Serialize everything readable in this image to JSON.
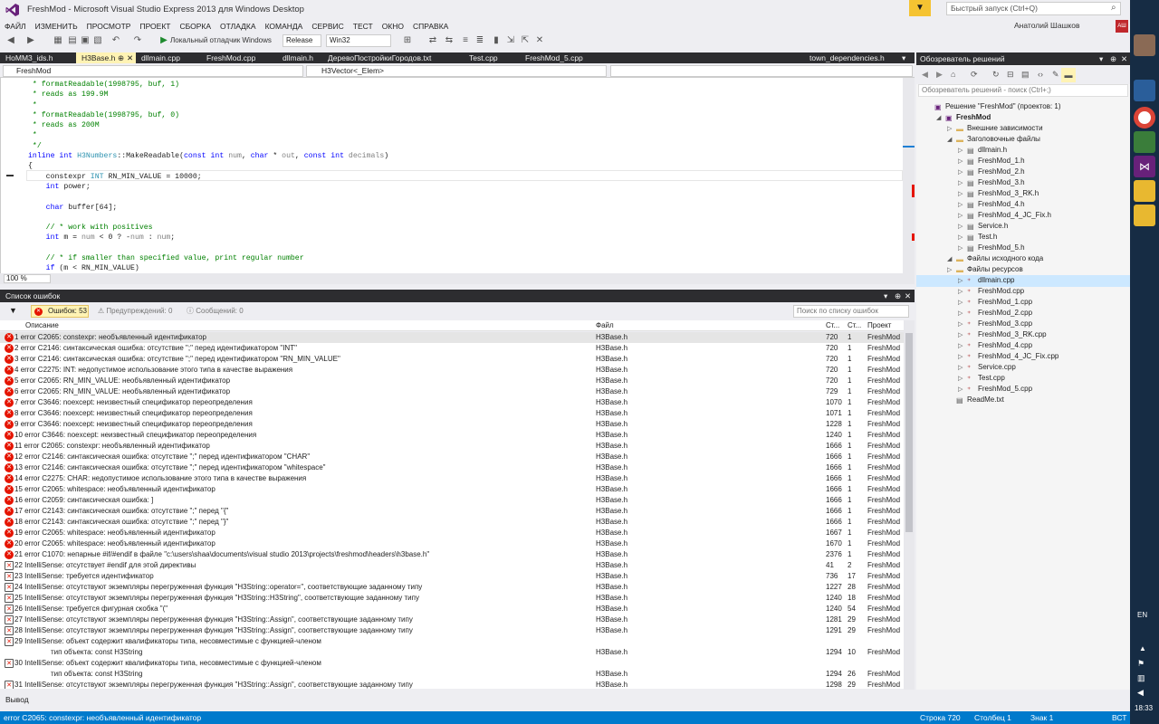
{
  "window": {
    "title": "FreshMod - Microsoft Visual Studio Express 2013 для Windows Desktop",
    "quick_launch": "Быстрый запуск (Ctrl+Q)",
    "user": "Анатолий Шашков",
    "user_badge": "АШ"
  },
  "menu": [
    "ФАЙЛ",
    "ИЗМЕНИТЬ",
    "ПРОСМОТР",
    "ПРОЕКТ",
    "СБОРКА",
    "ОТЛАДКА",
    "КОМАНДА",
    "СЕРВИС",
    "ТЕСТ",
    "ОКНО",
    "СПРАВКА"
  ],
  "toolbar": {
    "debugger": "Локальный отладчик Windows",
    "config": "Release",
    "platform": "Win32"
  },
  "tabs": [
    "HoMM3_ids.h",
    "H3Base.h",
    "dllmain.cpp",
    "FreshMod.cpp",
    "dllmain.h",
    "ДеревоПостройкиГородов.txt",
    "Test.cpp",
    "FreshMod_5.cpp",
    "town_dependencies.h"
  ],
  "nav": {
    "scope": "FreshMod",
    "symbol": "H3Vector<_Elem>"
  },
  "editor": {
    "zoom": "100 %"
  },
  "error_list": {
    "title": "Список ошибок",
    "errors_label": "Ошибок: 53",
    "warnings_label": "Предупреждений: 0",
    "messages_label": "Сообщений: 0",
    "search_placeholder": "Поиск по списку ошибок",
    "columns": {
      "description": "Описание",
      "file": "Файл",
      "line": "Ст...",
      "col": "Ст...",
      "project": "Проект"
    },
    "rows": [
      {
        "n": "1",
        "d": "error C2065: constexpr: необъявленный идентификатор",
        "f": "H3Base.h",
        "l": "720",
        "c": "1",
        "p": "FreshMod",
        "t": "e"
      },
      {
        "n": "2",
        "d": "error C2146: синтаксическая ошибка: отсутствие \";\" перед идентификатором \"INT\"",
        "f": "H3Base.h",
        "l": "720",
        "c": "1",
        "p": "FreshMod",
        "t": "e"
      },
      {
        "n": "3",
        "d": "error C2146: синтаксическая ошибка: отсутствие \";\" перед идентификатором \"RN_MIN_VALUE\"",
        "f": "H3Base.h",
        "l": "720",
        "c": "1",
        "p": "FreshMod",
        "t": "e"
      },
      {
        "n": "4",
        "d": "error C2275: INT: недопустимое использование этого типа в качестве выражения",
        "f": "H3Base.h",
        "l": "720",
        "c": "1",
        "p": "FreshMod",
        "t": "e"
      },
      {
        "n": "5",
        "d": "error C2065: RN_MIN_VALUE: необъявленный идентификатор",
        "f": "H3Base.h",
        "l": "720",
        "c": "1",
        "p": "FreshMod",
        "t": "e"
      },
      {
        "n": "6",
        "d": "error C2065: RN_MIN_VALUE: необъявленный идентификатор",
        "f": "H3Base.h",
        "l": "729",
        "c": "1",
        "p": "FreshMod",
        "t": "e"
      },
      {
        "n": "7",
        "d": "error C3646: noexcept: неизвестный спецификатор переопределения",
        "f": "H3Base.h",
        "l": "1070",
        "c": "1",
        "p": "FreshMod",
        "t": "e"
      },
      {
        "n": "8",
        "d": "error C3646: noexcept: неизвестный спецификатор переопределения",
        "f": "H3Base.h",
        "l": "1071",
        "c": "1",
        "p": "FreshMod",
        "t": "e"
      },
      {
        "n": "9",
        "d": "error C3646: noexcept: неизвестный спецификатор переопределения",
        "f": "H3Base.h",
        "l": "1228",
        "c": "1",
        "p": "FreshMod",
        "t": "e"
      },
      {
        "n": "10",
        "d": "error C3646: noexcept: неизвестный спецификатор переопределения",
        "f": "H3Base.h",
        "l": "1240",
        "c": "1",
        "p": "FreshMod",
        "t": "e"
      },
      {
        "n": "11",
        "d": "error C2065: constexpr: необъявленный идентификатор",
        "f": "H3Base.h",
        "l": "1666",
        "c": "1",
        "p": "FreshMod",
        "t": "e"
      },
      {
        "n": "12",
        "d": "error C2146: синтаксическая ошибка: отсутствие \";\" перед идентификатором \"CHAR\"",
        "f": "H3Base.h",
        "l": "1666",
        "c": "1",
        "p": "FreshMod",
        "t": "e"
      },
      {
        "n": "13",
        "d": "error C2146: синтаксическая ошибка: отсутствие \";\" перед идентификатором \"whitespace\"",
        "f": "H3Base.h",
        "l": "1666",
        "c": "1",
        "p": "FreshMod",
        "t": "e"
      },
      {
        "n": "14",
        "d": "error C2275: CHAR: недопустимое использование этого типа в качестве выражения",
        "f": "H3Base.h",
        "l": "1666",
        "c": "1",
        "p": "FreshMod",
        "t": "e"
      },
      {
        "n": "15",
        "d": "error C2065: whitespace: необъявленный идентификатор",
        "f": "H3Base.h",
        "l": "1666",
        "c": "1",
        "p": "FreshMod",
        "t": "e"
      },
      {
        "n": "16",
        "d": "error C2059: синтаксическая ошибка: ]",
        "f": "H3Base.h",
        "l": "1666",
        "c": "1",
        "p": "FreshMod",
        "t": "e"
      },
      {
        "n": "17",
        "d": "error C2143: синтаксическая ошибка: отсутствие \";\" перед \"{\"",
        "f": "H3Base.h",
        "l": "1666",
        "c": "1",
        "p": "FreshMod",
        "t": "e"
      },
      {
        "n": "18",
        "d": "error C2143: синтаксическая ошибка: отсутствие \";\" перед \"}\"",
        "f": "H3Base.h",
        "l": "1666",
        "c": "1",
        "p": "FreshMod",
        "t": "e"
      },
      {
        "n": "19",
        "d": "error C2065: whitespace: необъявленный идентификатор",
        "f": "H3Base.h",
        "l": "1667",
        "c": "1",
        "p": "FreshMod",
        "t": "e"
      },
      {
        "n": "20",
        "d": "error C2065: whitespace: необъявленный идентификатор",
        "f": "H3Base.h",
        "l": "1670",
        "c": "1",
        "p": "FreshMod",
        "t": "e"
      },
      {
        "n": "21",
        "d": "error C1070: непарные #if/#endif в файле \"c:\\users\\shaa\\documents\\visual studio 2013\\projects\\freshmod\\headers\\h3base.h\"",
        "f": "H3Base.h",
        "l": "2376",
        "c": "1",
        "p": "FreshMod",
        "t": "e"
      },
      {
        "n": "22",
        "d": "IntelliSense: отсутствует #endif для этой директивы",
        "f": "H3Base.h",
        "l": "41",
        "c": "2",
        "p": "FreshMod",
        "t": "i"
      },
      {
        "n": "23",
        "d": "IntelliSense: требуется идентификатор",
        "f": "H3Base.h",
        "l": "736",
        "c": "17",
        "p": "FreshMod",
        "t": "i"
      },
      {
        "n": "24",
        "d": "IntelliSense: отсутствуют экземпляры перегруженная функция \"H3String::operator=\", соответствующие заданному типу",
        "f": "H3Base.h",
        "l": "1227",
        "c": "28",
        "p": "FreshMod",
        "t": "i"
      },
      {
        "n": "25",
        "d": "IntelliSense: отсутствуют экземпляры перегруженная функция \"H3String::H3String\", соответствующие заданному типу",
        "f": "H3Base.h",
        "l": "1240",
        "c": "18",
        "p": "FreshMod",
        "t": "i"
      },
      {
        "n": "26",
        "d": "IntelliSense: требуется фигурная скобка \"(\"",
        "f": "H3Base.h",
        "l": "1240",
        "c": "54",
        "p": "FreshMod",
        "t": "i"
      },
      {
        "n": "27",
        "d": "IntelliSense: отсутствуют экземпляры перегруженная функция \"H3String::Assign\", соответствующие заданному типу",
        "f": "H3Base.h",
        "l": "1281",
        "c": "29",
        "p": "FreshMod",
        "t": "i"
      },
      {
        "n": "28",
        "d": "IntelliSense: отсутствуют экземпляры перегруженная функция \"H3String::Assign\", соответствующие заданному типу",
        "f": "H3Base.h",
        "l": "1291",
        "c": "29",
        "p": "FreshMod",
        "t": "i"
      },
      {
        "n": "29",
        "d": "IntelliSense: объект содержит квалификаторы типа, несовместимые с функцией-членом",
        "d2": "тип объекта: const H3String",
        "f": "H3Base.h",
        "l": "1294",
        "c": "10",
        "p": "FreshMod",
        "t": "i"
      },
      {
        "n": "30",
        "d": "IntelliSense: объект содержит квалификаторы типа, несовместимые с функцией-членом",
        "d2": "тип объекта: const H3String",
        "f": "H3Base.h",
        "l": "1294",
        "c": "26",
        "p": "FreshMod",
        "t": "i"
      },
      {
        "n": "31",
        "d": "IntelliSense: отсутствуют экземпляры перегруженная функция \"H3String::Assign\", соответствующие заданному типу",
        "f": "H3Base.h",
        "l": "1298",
        "c": "29",
        "p": "FreshMod",
        "t": "i"
      }
    ]
  },
  "output": {
    "title": "Вывод"
  },
  "solution_explorer": {
    "title": "Обозреватель решений",
    "search_placeholder": "Обозреватель решений - поиск (Ctrl+;)",
    "items": [
      {
        "label": "Решение \"FreshMod\" (проектов: 1)",
        "lvl": 0,
        "type": "solution"
      },
      {
        "label": "FreshMod",
        "lvl": 1,
        "type": "project"
      },
      {
        "label": "Внешние зависимости",
        "lvl": 2,
        "type": "folder"
      },
      {
        "label": "Заголовочные файлы",
        "lvl": 2,
        "type": "folder"
      },
      {
        "label": "dllmain.h",
        "lvl": 3,
        "type": "h"
      },
      {
        "label": "FreshMod_1.h",
        "lvl": 3,
        "type": "h"
      },
      {
        "label": "FreshMod_2.h",
        "lvl": 3,
        "type": "h"
      },
      {
        "label": "FreshMod_3.h",
        "lvl": 3,
        "type": "h"
      },
      {
        "label": "FreshMod_3_RK.h",
        "lvl": 3,
        "type": "h"
      },
      {
        "label": "FreshMod_4.h",
        "lvl": 3,
        "type": "h"
      },
      {
        "label": "FreshMod_4_JC_Fix.h",
        "lvl": 3,
        "type": "h"
      },
      {
        "label": "Service.h",
        "lvl": 3,
        "type": "h"
      },
      {
        "label": "Test.h",
        "lvl": 3,
        "type": "h"
      },
      {
        "label": "FreshMod_5.h",
        "lvl": 3,
        "type": "h"
      },
      {
        "label": "Файлы исходного кода",
        "lvl": 2,
        "type": "folder"
      },
      {
        "label": "Файлы ресурсов",
        "lvl": 2,
        "type": "folder"
      },
      {
        "label": "dllmain.cpp",
        "lvl": 3,
        "type": "cpp",
        "sel": true
      },
      {
        "label": "FreshMod.cpp",
        "lvl": 3,
        "type": "cpp"
      },
      {
        "label": "FreshMod_1.cpp",
        "lvl": 3,
        "type": "cpp"
      },
      {
        "label": "FreshMod_2.cpp",
        "lvl": 3,
        "type": "cpp"
      },
      {
        "label": "FreshMod_3.cpp",
        "lvl": 3,
        "type": "cpp"
      },
      {
        "label": "FreshMod_3_RK.cpp",
        "lvl": 3,
        "type": "cpp"
      },
      {
        "label": "FreshMod_4.cpp",
        "lvl": 3,
        "type": "cpp"
      },
      {
        "label": "FreshMod_4_JC_Fix.cpp",
        "lvl": 3,
        "type": "cpp"
      },
      {
        "label": "Service.cpp",
        "lvl": 3,
        "type": "cpp"
      },
      {
        "label": "Test.cpp",
        "lvl": 3,
        "type": "cpp"
      },
      {
        "label": "FreshMod_5.cpp",
        "lvl": 3,
        "type": "cpp"
      },
      {
        "label": "ReadMe.txt",
        "lvl": 2,
        "type": "txt"
      }
    ]
  },
  "status": {
    "message": "error C2065: constexpr: необъявленный идентификатор",
    "line": "Строка 720",
    "col": "Столбец 1",
    "char": "Знак 1",
    "mode": "ВСТ"
  },
  "taskbar": {
    "lang": "EN",
    "time": "18:33"
  }
}
